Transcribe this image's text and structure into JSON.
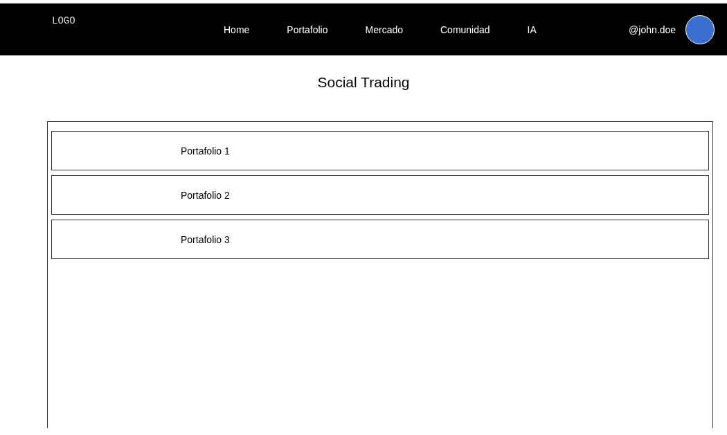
{
  "navbar": {
    "logo": "LOGO",
    "links": [
      "Home",
      "Portafolio",
      "Mercado",
      "Comunidad",
      "IA"
    ],
    "username": "@john.doe"
  },
  "page_title": "Social Trading",
  "portfolios": [
    {
      "name": "Portafolio 1"
    },
    {
      "name": "Portafolio 2"
    },
    {
      "name": "Portafolio 3"
    }
  ]
}
